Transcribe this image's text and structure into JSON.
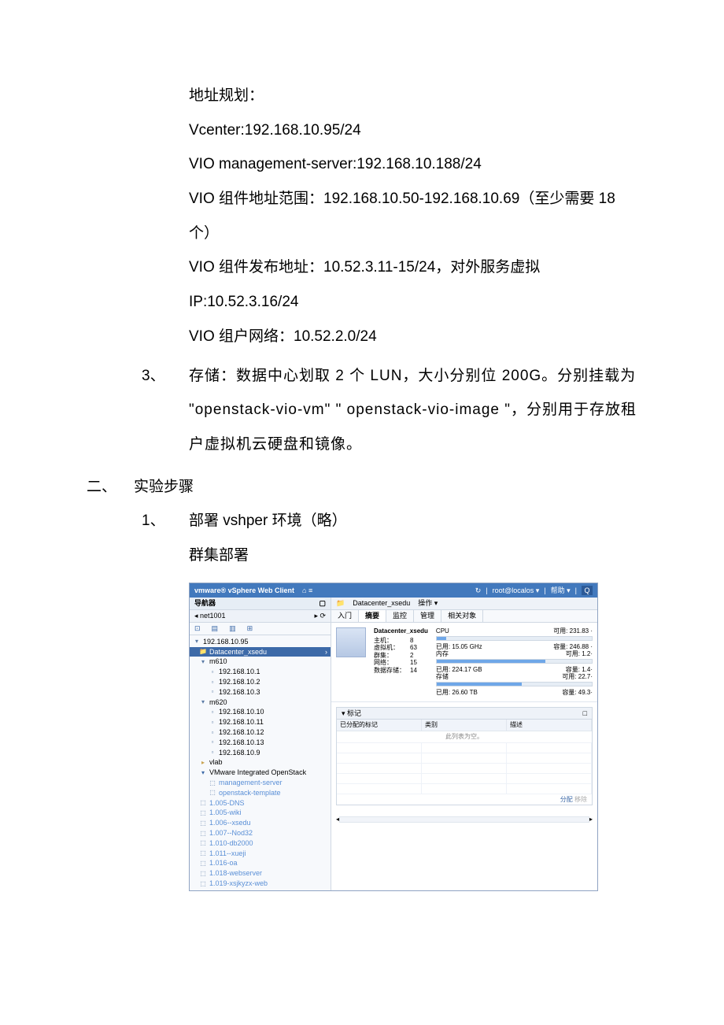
{
  "text": {
    "addr_title": "地址规划：",
    "vcenter": "Vcenter:192.168.10.95/24",
    "vio_mgmt": "VIO management-server:192.168.10.188/24",
    "vio_range": "VIO 组件地址范围：192.168.10.50-192.168.10.69（至少需要 18 个）",
    "vio_pub": "VIO 组件发布地址：10.52.3.11-15/24，对外服务虚拟IP:10.52.3.16/24",
    "vio_tenant": "VIO 组户网络：10.52.2.0/24",
    "item3_num": "3、",
    "item3_body": "存储：数据中心划取 2 个 LUN，大小分别位 200G。分别挂载为 \"openstack-vio-vm\" \" openstack-vio-image \"，分别用于存放租户虚拟机云硬盘和镜像。",
    "sec2_num": "二、",
    "sec2_title": "实验步骤",
    "step1_num": "1、",
    "step1_body": "部署 vshper 环境（略）",
    "cluster": "群集部署"
  },
  "scr": {
    "brand": "vmware® vSphere Web Client",
    "home_icon": "⌂ ≡",
    "refresh": "↻",
    "user": "root@localos ▾",
    "help": "帮助 ▾",
    "search_icon": "Q",
    "nav_title": "导航器",
    "nav_pin": "▢",
    "nav_back": "◂ net1001",
    "nav_back_icons": "▸ ⟳",
    "iconrow": [
      "⊡",
      "▤",
      "▥",
      "⊞"
    ],
    "tree": [
      {
        "ic": "▾",
        "txt": "192.168.10.95",
        "cls": "d0"
      },
      {
        "ic": "📁",
        "txt": "Datacenter_xsedu",
        "cls": "d1 sel",
        "arrow": "›"
      },
      {
        "ic": "▾",
        "txt": "m610",
        "cls": "d1"
      },
      {
        "ic": "▫",
        "txt": "192.168.10.1",
        "cls": "d2"
      },
      {
        "ic": "▫",
        "txt": "192.168.10.2",
        "cls": "d2"
      },
      {
        "ic": "▫",
        "txt": "192.168.10.3",
        "cls": "d2"
      },
      {
        "ic": "▾",
        "txt": "m620",
        "cls": "d1"
      },
      {
        "ic": "▫",
        "txt": "192.168.10.10",
        "cls": "d2"
      },
      {
        "ic": "▫",
        "txt": "192.168.10.11",
        "cls": "d2"
      },
      {
        "ic": "▫",
        "txt": "192.168.10.12",
        "cls": "d2"
      },
      {
        "ic": "▫",
        "txt": "192.168.10.13",
        "cls": "d2"
      },
      {
        "ic": "▫",
        "txt": "192.168.10.9",
        "cls": "d2"
      },
      {
        "ic": "▸",
        "txt": "vlab",
        "cls": "d1",
        "col": "#c9a24f"
      },
      {
        "ic": "▾",
        "txt": "VMware Integrated OpenStack",
        "cls": "d1",
        "col": "#3d6aa8"
      },
      {
        "ic": "⬚",
        "txt": "management-server",
        "cls": "d2 vmic"
      },
      {
        "ic": "⬚",
        "txt": "openstack-template",
        "cls": "d2 vmic"
      },
      {
        "ic": "⬚",
        "txt": "1.005-DNS",
        "cls": "d1 vmic"
      },
      {
        "ic": "⬚",
        "txt": "1.005-wiki",
        "cls": "d1 vmic"
      },
      {
        "ic": "⬚",
        "txt": "1.006--xsedu",
        "cls": "d1 vmic"
      },
      {
        "ic": "⬚",
        "txt": "1.007--Nod32",
        "cls": "d1 vmic"
      },
      {
        "ic": "⬚",
        "txt": "1.010-db2000",
        "cls": "d1 vmic"
      },
      {
        "ic": "⬚",
        "txt": "1.011--xueji",
        "cls": "d1 vmic"
      },
      {
        "ic": "⬚",
        "txt": "1.016-oa",
        "cls": "d1 vmic"
      },
      {
        "ic": "⬚",
        "txt": "1.018-webserver",
        "cls": "d1 vmic"
      },
      {
        "ic": "⬚",
        "txt": "1.019-xsjkyzx-web",
        "cls": "d1 vmic"
      }
    ],
    "crumb_folder": "📁",
    "crumb_name": "Datacenter_xsedu",
    "crumb_action": "操作 ▾",
    "tabs": [
      "入门",
      "摘要",
      "监控",
      "管理",
      "相关对象"
    ],
    "active_tab": 1,
    "obj_title": "Datacenter_xsedu",
    "kv": [
      {
        "k": "主机：",
        "v": "8"
      },
      {
        "k": "虚拟机：",
        "v": "63"
      },
      {
        "k": "群集：",
        "v": "2"
      },
      {
        "k": "网络：",
        "v": "15"
      },
      {
        "k": "数据存储：",
        "v": "14"
      }
    ],
    "stats": [
      {
        "label": "CPU",
        "used": "已用: 15.05 GHz",
        "free": "可用: 231.83 ·",
        "cap": "容量: 246.88 ·",
        "pct": 6
      },
      {
        "label": "内存",
        "used": "已用: 224.17 GB",
        "free": "可用: 1.2·",
        "cap": "容量: 1.4·",
        "pct": 70
      },
      {
        "label": "存储",
        "used": "已用: 26.60 TB",
        "free": "可用: 22.7·",
        "cap": "容量: 49.3·",
        "pct": 55
      }
    ],
    "tag_header": "▾ 标记",
    "tag_box": "□",
    "tag_cols": [
      "已分配的标记",
      "类别",
      "描述"
    ],
    "tag_empty": "此列表为空。",
    "assign": "分配",
    "remove": "移除"
  }
}
